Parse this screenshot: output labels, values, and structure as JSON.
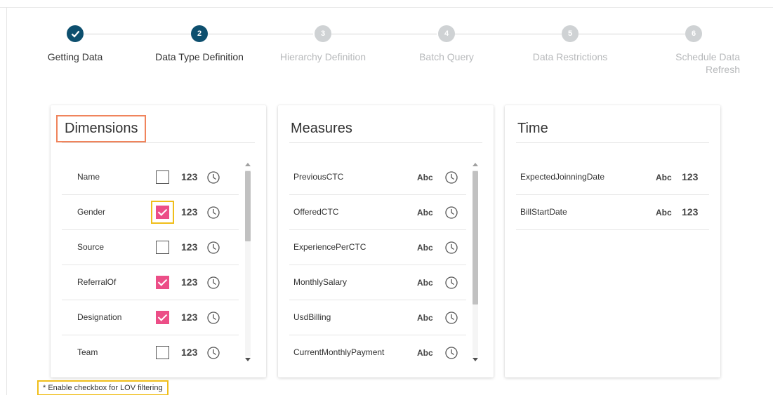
{
  "stepper": {
    "steps": [
      {
        "number": "1",
        "label": "Getting Data",
        "state": "done"
      },
      {
        "number": "2",
        "label": "Data Type Definition",
        "state": "active"
      },
      {
        "number": "3",
        "label": "Hierarchy Definition",
        "state": "pending"
      },
      {
        "number": "4",
        "label": "Batch Query",
        "state": "pending"
      },
      {
        "number": "5",
        "label": "Data Restrictions",
        "state": "pending"
      },
      {
        "number": "6",
        "label": "Schedule Data Refresh",
        "state": "pending"
      }
    ]
  },
  "dimensions": {
    "title": "Dimensions",
    "rows": [
      {
        "name": "Name",
        "checked": false,
        "type_label": "123",
        "icon": "clock-icon"
      },
      {
        "name": "Gender",
        "checked": true,
        "type_label": "123",
        "icon": "clock-icon"
      },
      {
        "name": "Source",
        "checked": false,
        "type_label": "123",
        "icon": "clock-icon"
      },
      {
        "name": "ReferralOf",
        "checked": true,
        "type_label": "123",
        "icon": "clock-icon"
      },
      {
        "name": "Designation",
        "checked": true,
        "type_label": "123",
        "icon": "clock-icon"
      },
      {
        "name": "Team",
        "checked": false,
        "type_label": "123",
        "icon": "clock-icon"
      }
    ]
  },
  "measures": {
    "title": "Measures",
    "rows": [
      {
        "name": "PreviousCTC",
        "type_label": "Abc",
        "icon": "clock-icon"
      },
      {
        "name": "OfferedCTC",
        "type_label": "Abc",
        "icon": "clock-icon"
      },
      {
        "name": "ExperiencePerCTC",
        "type_label": "Abc",
        "icon": "clock-icon"
      },
      {
        "name": "MonthlySalary",
        "type_label": "Abc",
        "icon": "clock-icon"
      },
      {
        "name": "UsdBilling",
        "type_label": "Abc",
        "icon": "clock-icon"
      },
      {
        "name": "CurrentMonthlyPayment",
        "type_label": "Abc",
        "icon": "clock-icon"
      }
    ]
  },
  "time": {
    "title": "Time",
    "rows": [
      {
        "name": "ExpectedJoinningDate",
        "type_label_1": "Abc",
        "type_label_2": "123"
      },
      {
        "name": "BillStartDate",
        "type_label_1": "Abc",
        "type_label_2": "123"
      }
    ]
  },
  "note": "* Enable checkbox for LOV filtering",
  "colors": {
    "accent": "#0d4f6e",
    "checkbox": "#ec4e87",
    "highlight_yellow": "#f0be1a",
    "highlight_orange": "#f0845c",
    "pending_step": "#cfd2d4"
  }
}
